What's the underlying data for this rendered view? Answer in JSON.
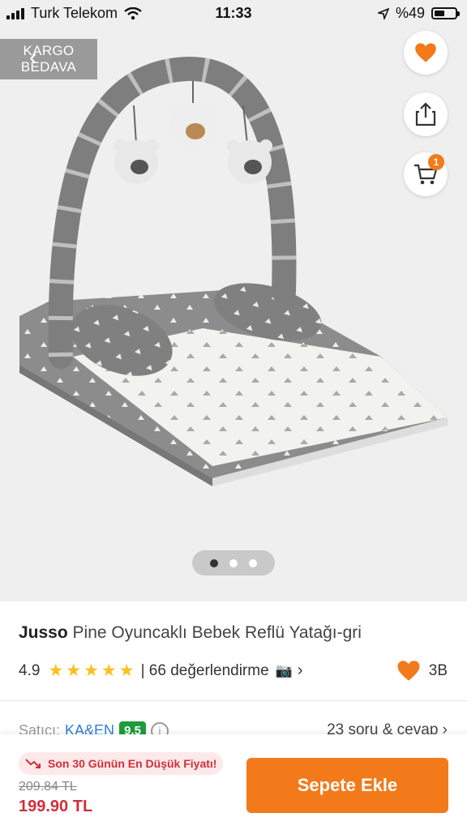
{
  "status_bar": {
    "carrier": "Turk Telekom",
    "time": "11:33",
    "battery": "%49",
    "battery_level": 0.49
  },
  "hero": {
    "shipping_badge_line1": "KARGO",
    "shipping_badge_line2": "BEDAVA",
    "cart_count": "1",
    "image_count": 3,
    "active_image": 0
  },
  "product": {
    "brand": "Jusso",
    "name": "Pine Oyuncaklı Bebek Reflü Yatağı-gri",
    "rating": "4.9",
    "stars": 5,
    "reviews": "| 66 değerlendirme",
    "favorites": "3B"
  },
  "seller": {
    "label": "Satıcı:",
    "name": "KA&EN",
    "score": "9.5",
    "qa_link": "23 soru & cevap ›"
  },
  "purchase": {
    "lowest_price_note": "Son 30 Günün En Düşük Fiyatı!",
    "old_price": "209.84 TL",
    "price": "199.90 TL",
    "add_to_cart": "Sepete Ekle"
  },
  "colors": {
    "accent": "#f27a1a",
    "price_red": "#d0303a",
    "star": "#fcbf1e",
    "seller_score": "#1f9c3a"
  }
}
